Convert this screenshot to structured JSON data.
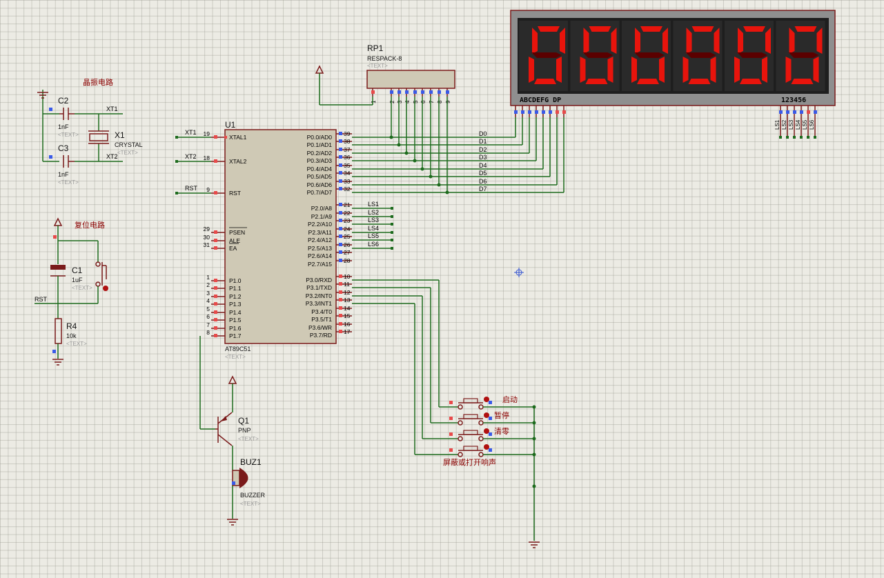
{
  "crystal": {
    "title": "晶振电路",
    "c2_ref": "C2",
    "c2_val": "1nF",
    "c2_text": "<TEXT>",
    "c3_ref": "C3",
    "c3_val": "1nF",
    "c3_text": "<TEXT>",
    "x1_ref": "X1",
    "x1_val": "CRYSTAL",
    "x1_text": "<TEXT>",
    "net_xt1": "XT1",
    "net_xt2": "XT2"
  },
  "reset": {
    "title": "复位电路",
    "c1_ref": "C1",
    "c1_val": "1uF",
    "c1_text": "<TEXT>",
    "r4_ref": "R4",
    "r4_val": "10k",
    "r4_text": "<TEXT>",
    "net_rst": "RST"
  },
  "rp1": {
    "ref": "RP1",
    "val": "RESPACK-8",
    "text": "<TEXT>",
    "pins": [
      "1",
      "2",
      "3",
      "4",
      "5",
      "6",
      "7",
      "8",
      "9"
    ]
  },
  "mcu": {
    "ref": "U1",
    "val": "AT89C51",
    "text": "<TEXT>",
    "left_pins": [
      {
        "num": "19",
        "label": "XTAL1",
        "net": "XT1"
      },
      {
        "num": "18",
        "label": "XTAL2",
        "net": "XT2"
      },
      {
        "num": "9",
        "label": "RST",
        "net": "RST"
      },
      {
        "num": "29",
        "label": "PSEN",
        "net": ""
      },
      {
        "num": "30",
        "label": "ALE",
        "net": ""
      },
      {
        "num": "31",
        "label": "EA",
        "net": ""
      },
      {
        "num": "1",
        "label": "P1.0",
        "net": ""
      },
      {
        "num": "2",
        "label": "P1.1",
        "net": ""
      },
      {
        "num": "3",
        "label": "P1.2",
        "net": ""
      },
      {
        "num": "4",
        "label": "P1.3",
        "net": ""
      },
      {
        "num": "5",
        "label": "P1.4",
        "net": ""
      },
      {
        "num": "6",
        "label": "P1.5",
        "net": ""
      },
      {
        "num": "7",
        "label": "P1.6",
        "net": ""
      },
      {
        "num": "8",
        "label": "P1.7",
        "net": ""
      }
    ],
    "right_pins": [
      {
        "num": "39",
        "label": "P0.0/AD0",
        "net": "D0"
      },
      {
        "num": "38",
        "label": "P0.1/AD1",
        "net": "D1"
      },
      {
        "num": "37",
        "label": "P0.2/AD2",
        "net": "D2"
      },
      {
        "num": "36",
        "label": "P0.3/AD3",
        "net": "D3"
      },
      {
        "num": "35",
        "label": "P0.4/AD4",
        "net": "D4"
      },
      {
        "num": "34",
        "label": "P0.5/AD5",
        "net": "D5"
      },
      {
        "num": "33",
        "label": "P0.6/AD6",
        "net": "D6"
      },
      {
        "num": "32",
        "label": "P0.7/AD7",
        "net": "D7"
      },
      {
        "num": "21",
        "label": "P2.0/A8",
        "net": "LS1"
      },
      {
        "num": "22",
        "label": "P2.1/A9",
        "net": "LS2"
      },
      {
        "num": "23",
        "label": "P2.2/A10",
        "net": "LS3"
      },
      {
        "num": "24",
        "label": "P2.3/A11",
        "net": "LS4"
      },
      {
        "num": "25",
        "label": "P2.4/A12",
        "net": "LS5"
      },
      {
        "num": "26",
        "label": "P2.5/A13",
        "net": "LS6"
      },
      {
        "num": "27",
        "label": "P2.6/A14",
        "net": ""
      },
      {
        "num": "28",
        "label": "P2.7/A15",
        "net": ""
      },
      {
        "num": "10",
        "label": "P3.0/RXD",
        "net": ""
      },
      {
        "num": "11",
        "label": "P3.1/TXD",
        "net": ""
      },
      {
        "num": "12",
        "label": "P3.2/INT0",
        "net": ""
      },
      {
        "num": "13",
        "label": "P3.3/INT1",
        "net": ""
      },
      {
        "num": "14",
        "label": "P3.4/T0",
        "net": ""
      },
      {
        "num": "15",
        "label": "P3.5/T1",
        "net": ""
      },
      {
        "num": "16",
        "label": "P3.6/WR",
        "net": ""
      },
      {
        "num": "17",
        "label": "P3.7/RD",
        "net": ""
      }
    ]
  },
  "display": {
    "digits": [
      "0",
      "0",
      "0",
      "0",
      "0",
      "0"
    ],
    "seg_label": "ABCDEFG DP",
    "com_label": "123456",
    "com_nets": [
      "LS1",
      "LS2",
      "LS3",
      "LS4",
      "LS5",
      "LS6"
    ],
    "seg_color": "#e8140c"
  },
  "transistor": {
    "ref": "Q1",
    "val": "PNP",
    "text": "<TEXT>"
  },
  "buzzer": {
    "ref": "BUZ1",
    "val": "BUZZER",
    "text": "<TEXT>"
  },
  "buttons": [
    {
      "label": "启动"
    },
    {
      "label": "暂停"
    },
    {
      "label": "清零"
    },
    {
      "label": "屏蔽或打开响声"
    }
  ],
  "colors": {
    "wire": "#1d6b1d",
    "device": "#7a1a1a",
    "body": "#cfc9b5",
    "background": "#ecebe4"
  }
}
